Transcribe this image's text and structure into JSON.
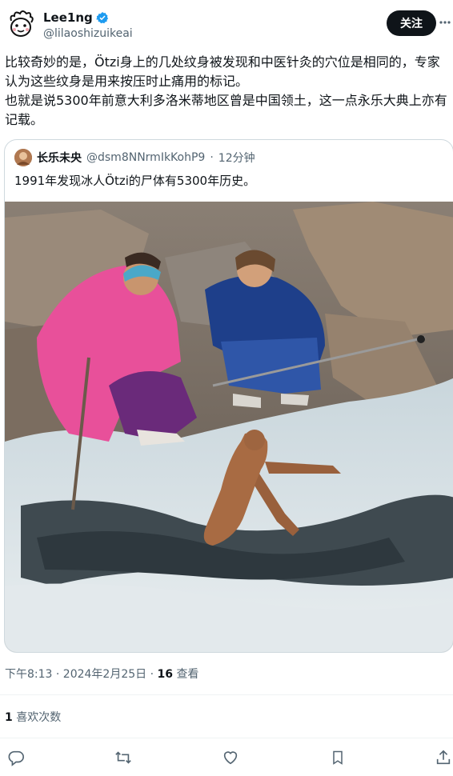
{
  "author": {
    "display_name": "Lee1ng",
    "handle": "@lilaoshizuikeai",
    "verified": true
  },
  "follow_label": "关注",
  "tweet_text": "比较奇妙的是，Ötzi身上的几处纹身被发现和中医针灸的穴位是相同的，专家认为这些纹身是用来按压时止痛用的标记。\n也就是说5300年前意大利多洛米蒂地区曾是中国领土，这一点永乐大典上亦有记载。",
  "quote": {
    "display_name": "长乐未央",
    "handle": "@dsm8NNrmIkKohP9",
    "separator": "·",
    "time": "12分钟",
    "text": "1991年发现冰人Ötzi的尸体有5300年历史。"
  },
  "meta": {
    "timestamp": "下午8:13 · 2024年2月25日 ·",
    "views_count": "16",
    "views_label": "查看"
  },
  "likes": {
    "count": "1",
    "label": "喜欢次数"
  },
  "icons": [
    "verified-badge-icon",
    "more-icon",
    "reply-icon",
    "retweet-icon",
    "like-icon",
    "bookmark-icon",
    "share-icon"
  ],
  "colors": {
    "accent": "#1d9bf0",
    "text": "#0f1419",
    "secondary": "#536471",
    "border": "#cfd9de"
  }
}
